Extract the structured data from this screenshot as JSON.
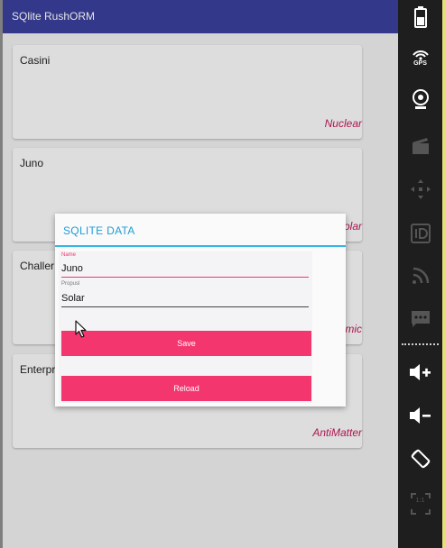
{
  "app_title": "SQlite RushORM",
  "cards": [
    {
      "name": "Casini",
      "propulsion": "Nuclear"
    },
    {
      "name": "Juno",
      "propulsion": "Solar"
    },
    {
      "name": "Challer",
      "propulsion": "Chemic"
    },
    {
      "name": "Enterpr",
      "propulsion": "AntiMatter"
    }
  ],
  "dialog": {
    "title": "SQLITE DATA",
    "name_label": "Name",
    "name_value": "Juno",
    "propulsion_label": "Propusl",
    "propulsion_value": "Solar",
    "save_label": "Save",
    "reload_label": "Reload"
  },
  "sidebar": {
    "gps_label": "GPS",
    "id_label": "ID",
    "zoom_label": "1:1"
  },
  "colors": {
    "app_bar": "#3a3f9a",
    "accent_pink": "#f4366f",
    "dialog_title": "#1e9ed6",
    "propulsion_text": "#c2185b"
  }
}
